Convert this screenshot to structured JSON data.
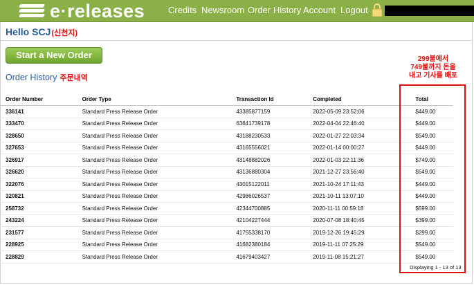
{
  "header": {
    "logo_text": "e·releases",
    "nav": [
      "Credits",
      "Newsroom",
      "Order History",
      "Account",
      "Logout"
    ]
  },
  "greeting": {
    "text": "Hello SCJ",
    "note_kr": "(신천지)"
  },
  "new_order_button": "Start a New Order",
  "order_history": {
    "title": "Order History",
    "note_kr": "주문내역"
  },
  "annotation": {
    "line1": "299불에서",
    "line2": "749불까지 돈을",
    "line3": "내고 기사를 배포"
  },
  "table": {
    "columns": [
      "Order Number",
      "Order Type",
      "Transaction Id",
      "Completed",
      "Total"
    ],
    "rows": [
      [
        "336141",
        "Standard Press Release Order",
        "43385877159",
        "2022-05-09 23:52:06",
        "$449.00"
      ],
      [
        "333470",
        "Standard Press Release Order",
        "63641739178",
        "2022-04-04 22:46:40",
        "$449.00"
      ],
      [
        "328650",
        "Standard Press Release Order",
        "43188230533",
        "2022-01-27 22:03:34",
        "$549.00"
      ],
      [
        "327653",
        "Standard Press Release Order",
        "43165556021",
        "2022-01-14 00:00:27",
        "$449.00"
      ],
      [
        "326917",
        "Standard Press Release Order",
        "43148882026",
        "2022-01-03 22:11:36",
        "$749.00"
      ],
      [
        "326620",
        "Standard Press Release Order",
        "43136880304",
        "2021-12-27 23:56:40",
        "$549.00"
      ],
      [
        "322076",
        "Standard Press Release Order",
        "43015122011",
        "2021-10-24 17:11:43",
        "$449.00"
      ],
      [
        "320821",
        "Standard Press Release Order",
        "42986026537",
        "2021-10-11 13:07:10",
        "$449.00"
      ],
      [
        "258732",
        "Standard Press Release Order",
        "42344700885",
        "2020-11-11 00:59:18",
        "$599.00"
      ],
      [
        "243224",
        "Standard Press Release Order",
        "42104227444",
        "2020-07-08 18:40:45",
        "$399.00"
      ],
      [
        "231577",
        "Standard Press Release Order",
        "41755338170",
        "2019-12-26 19:45:29",
        "$299.00"
      ],
      [
        "228925",
        "Standard Press Release Order",
        "41682380184",
        "2019-11-11 07:25:29",
        "$549.00"
      ],
      [
        "228829",
        "Standard Press Release Order",
        "41679403427",
        "2019-11-08 15:21:27",
        "$549.00"
      ]
    ],
    "footer": "Displaying 1 - 13 of 13"
  },
  "colors": {
    "header_green": "#8ab047",
    "link_blue": "#2a5b9a",
    "annotation_red": "#e01010"
  }
}
